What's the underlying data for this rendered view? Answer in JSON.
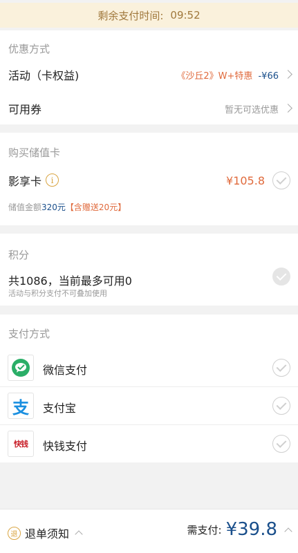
{
  "timer": {
    "label": "剩余支付时间:",
    "value": "09:52"
  },
  "discount": {
    "title": "优惠方式",
    "activity_label": "活动（卡权益)",
    "activity_movie": "《沙丘2》W+特惠",
    "activity_amount": "-¥66",
    "coupon_label": "可用券",
    "coupon_value": "暂无可选优惠"
  },
  "stored_card": {
    "title": "购买储值卡",
    "card_name": "影享卡",
    "info_icon_glyph": "i",
    "price": "¥105.8",
    "amount_prefix": "储值金额",
    "amount_value": "320元",
    "gift": "【含赠送20元】"
  },
  "points": {
    "title": "积分",
    "summary": "共1086，当前最多可用0",
    "note": "活动与积分支付不可叠加使用"
  },
  "payment": {
    "title": "支付方式",
    "methods": [
      {
        "label": "微信支付",
        "icon": "wechat-pay-icon"
      },
      {
        "label": "支付宝",
        "icon": "alipay-icon",
        "glyph": "支"
      },
      {
        "label": "快钱支付",
        "icon": "kuaiqian-icon",
        "glyph": "快钱"
      }
    ]
  },
  "footer": {
    "refund_badge": "退",
    "refund_label": "退单须知",
    "pay_label": "需支付:",
    "pay_amount": "¥39.8"
  },
  "colors": {
    "accent_orange": "#e06a3c",
    "accent_blue": "#1a4f8b",
    "timer_bg": "#faf1dc",
    "timer_text": "#a0783c",
    "wechat_green": "#2aae67",
    "alipay_blue": "#1a8fe0",
    "kuaiqian_red": "#c81e28"
  }
}
